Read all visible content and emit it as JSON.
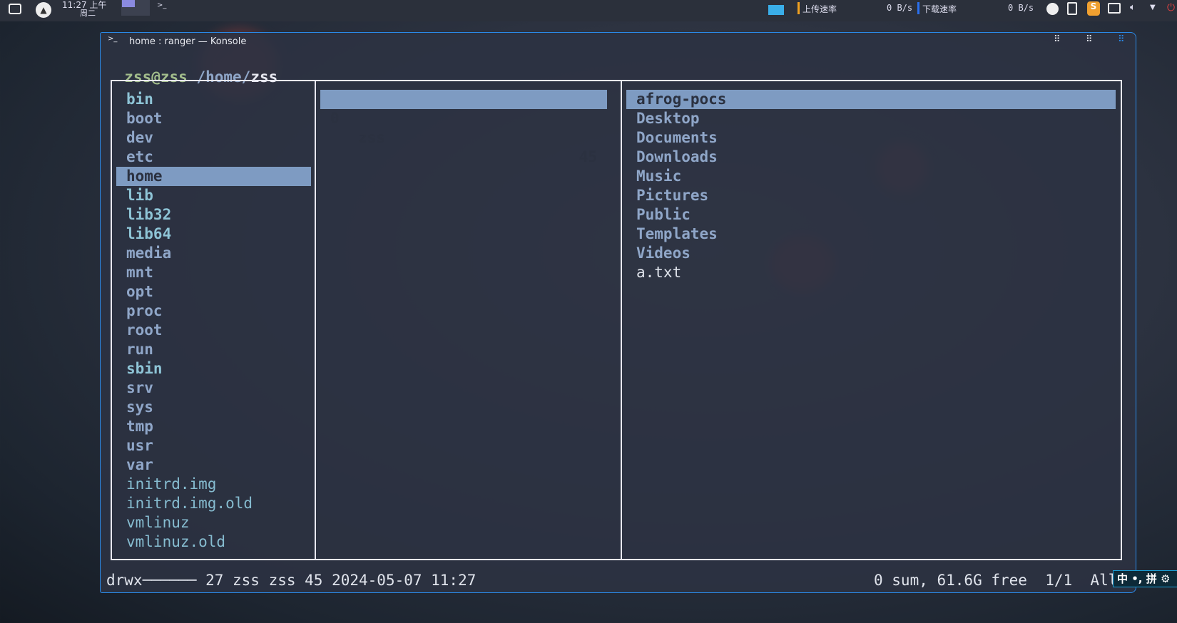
{
  "taskbar": {
    "clock": "11:27 上午",
    "weekday": "周二",
    "upload_label": "上传速率",
    "upload_value": "0 B/s",
    "download_label": "下载速率",
    "download_value": "0 B/s"
  },
  "window": {
    "title": "home : ranger — Konsole"
  },
  "prompt": {
    "user_host": "zss@zss",
    "path": "/home/",
    "current": "zss"
  },
  "parent_column": [
    "bin",
    "boot",
    "dev",
    "etc",
    "home",
    "lib",
    "lib32",
    "lib64",
    "media",
    "mnt",
    "opt",
    "proc",
    "root",
    "run",
    "sbin",
    "srv",
    "sys",
    "tmp",
    "usr",
    "var",
    "initrd.img",
    "initrd.img.old",
    "vmlinuz",
    "vmlinuz.old"
  ],
  "parent_types": [
    "link",
    "dir",
    "dir",
    "dir",
    "dir",
    "link",
    "link",
    "link",
    "dir",
    "dir",
    "dir",
    "dir",
    "dir",
    "dir",
    "link",
    "dir",
    "dir",
    "dir",
    "dir",
    "dir",
    "file",
    "file",
    "file",
    "file"
  ],
  "parent_selected": 4,
  "current_column": [
    {
      "index": "0",
      "name": "zss",
      "count": "45"
    }
  ],
  "preview_column": [
    "afrog-pocs",
    "Desktop",
    "Documents",
    "Downloads",
    "Music",
    "Pictures",
    "Public",
    "Templates",
    "Videos",
    "a.txt"
  ],
  "preview_types": [
    "dir",
    "dir",
    "dir",
    "dir",
    "dir",
    "dir",
    "dir",
    "dir",
    "dir",
    "plain"
  ],
  "status": {
    "left": "drwx────── 27 zss zss 45 2024-05-07 11:27",
    "right": "0 sum, 61.6G free  1/1  All"
  },
  "ime": {
    "label": "中 •, 拼 ⚙"
  },
  "colors": {
    "accent": "#2a8bea",
    "selection": "#7e9bc2",
    "dir": "#8fa6c8",
    "link": "#8ec4d6",
    "prompt_user": "#a3be8c"
  }
}
